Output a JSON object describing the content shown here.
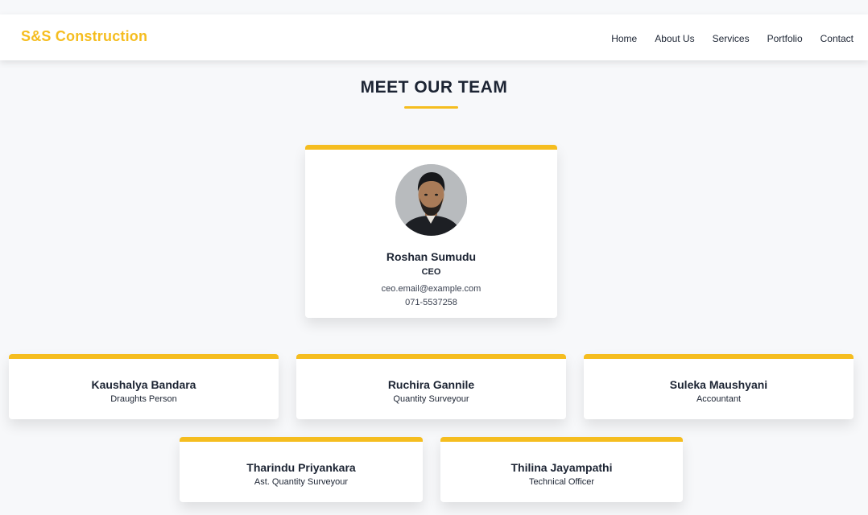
{
  "header": {
    "brand": "S&S Construction",
    "nav": [
      "Home",
      "About Us",
      "Services",
      "Portfolio",
      "Contact"
    ]
  },
  "section": {
    "title": "MEET OUR TEAM"
  },
  "ceo": {
    "name": "Roshan Sumudu",
    "role": "CEO",
    "email": "ceo.email@example.com",
    "phone": "071-5537258"
  },
  "team": [
    {
      "name": "Kaushalya Bandara",
      "role": "Draughts Person"
    },
    {
      "name": "Ruchira Gannile",
      "role": "Quantity Surveyour"
    },
    {
      "name": "Suleka Maushyani",
      "role": "Accountant"
    },
    {
      "name": "Tharindu Priyankara",
      "role": "Ast. Quantity Surveyour"
    },
    {
      "name": "Thilina Jayampathi",
      "role": "Technical Officer"
    }
  ],
  "colors": {
    "accent": "#f5bd1f",
    "text": "#1c2433",
    "background": "#f7f8fa"
  }
}
